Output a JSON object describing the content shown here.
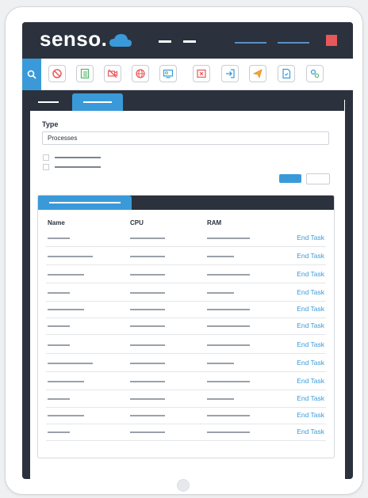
{
  "app": {
    "logo_text": "senso.",
    "accent_color": "#3a9ad9",
    "dark_color": "#2b323d",
    "alert_color": "#e8585a"
  },
  "toolbar": {
    "icons": [
      "search-icon",
      "block-icon",
      "checklist-icon",
      "no-video-icon",
      "globe-icon",
      "remote-desktop-icon",
      "close-window-icon",
      "login-icon",
      "send-icon",
      "document-icon",
      "settings-icon"
    ]
  },
  "form": {
    "type_label": "Type",
    "type_value": "Processes"
  },
  "table": {
    "headers": {
      "name": "Name",
      "cpu": "CPU",
      "ram": "RAM"
    },
    "action_label": "End Task",
    "rows": [
      {
        "action": "End Task"
      },
      {
        "action": "End Task"
      },
      {
        "action": "End Task"
      },
      {
        "action": "End Task"
      },
      {
        "action": "End Task"
      },
      {
        "action": "End Task"
      },
      {
        "action": "End Task"
      },
      {
        "action": "End Task"
      },
      {
        "action": "End Task"
      },
      {
        "action": "End Task"
      },
      {
        "action": "End Task"
      },
      {
        "action": "End Task"
      }
    ]
  }
}
